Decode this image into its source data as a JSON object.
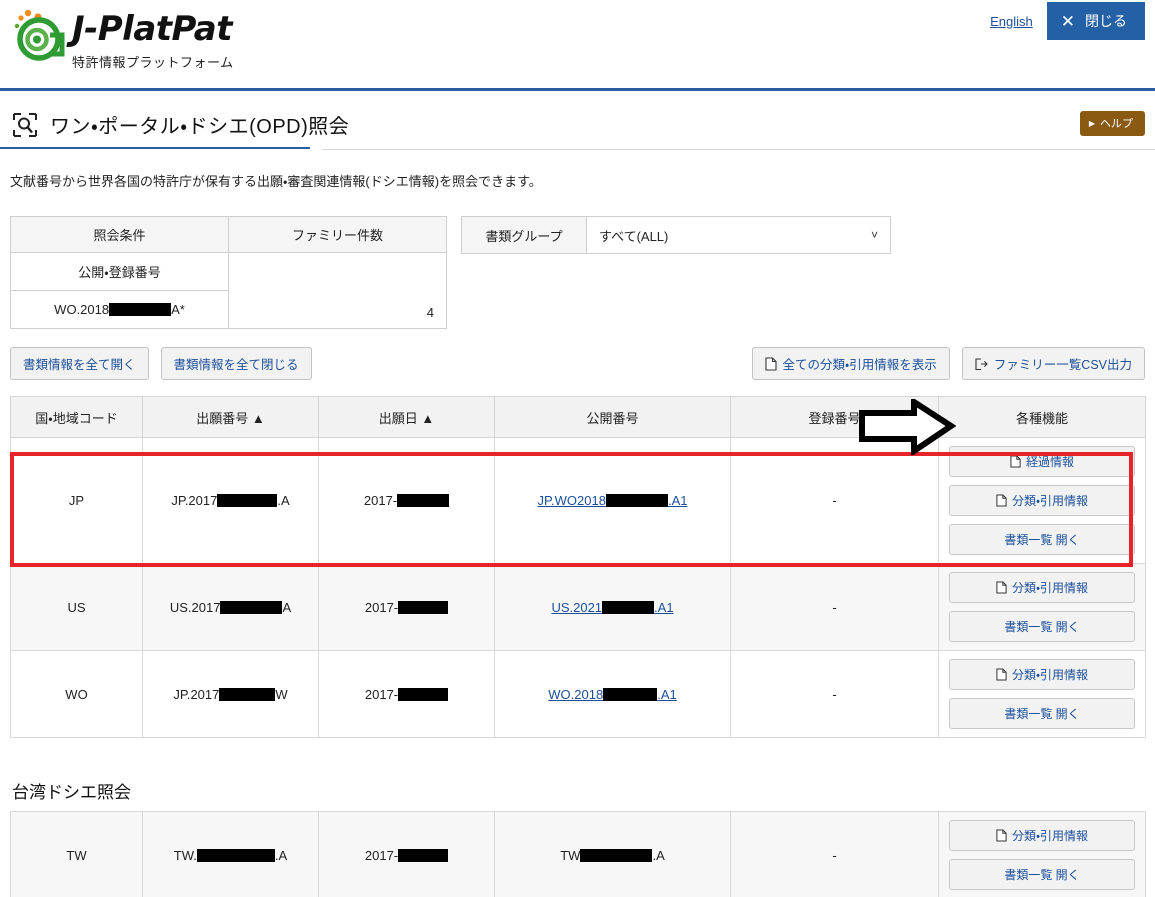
{
  "header": {
    "logo_word": "J-PlatPat",
    "logo_sub": "特許情報プラットフォーム",
    "english_link": "English",
    "close_label": "閉じる",
    "close_icon": "close-x-icon"
  },
  "title": {
    "text": "ワン・ポータル・ドシエ(OPD)照会",
    "icon": "search-document-icon",
    "help_label": "ヘルプ",
    "help_icon": "play-caret-icon"
  },
  "description": "文献番号から世界各国の特許庁が保有する出願・審査関連情報(ドシエ情報)を照会できます。",
  "condition": {
    "headers": [
      "照会条件",
      "ファミリー件数"
    ],
    "row_label": "公開・登録番号",
    "row_value_prefix": "WO.2018",
    "row_value_suffix": "A*",
    "family_count": "4"
  },
  "document_group": {
    "label": "書類グループ",
    "selected": "すべて(ALL)",
    "chevron_icon": "chevron-down-icon"
  },
  "actions": {
    "open_all": "書類情報を全て開く",
    "close_all": "書類情報を全て閉じる",
    "show_all_citations": "全ての分類・引用情報を表示",
    "csv_export": "ファミリー一覧CSV出力",
    "doc_icon": "document-icon",
    "export_icon": "export-icon"
  },
  "table": {
    "headers": [
      "国・地域コード",
      "出願番号 ▲",
      "出願日 ▲",
      "公開番号",
      "登録番号",
      "各種機能"
    ],
    "rows": [
      {
        "country": "JP",
        "app_prefix": "JP.2017",
        "app_suffix": ".A",
        "date_prefix": "2017-",
        "date_suffix": "",
        "pub_prefix": "JP.WO2018",
        "pub_suffix": ".A1",
        "pub_is_link": true,
        "reg": "-",
        "buttons": [
          "経過情報",
          "分類・引用情報",
          "書類一覧 開く"
        ]
      },
      {
        "country": "US",
        "app_prefix": "US.2017",
        "app_suffix": "A",
        "date_prefix": "2017-",
        "date_suffix": "",
        "pub_prefix": "US.2021",
        "pub_suffix": ".A1",
        "pub_is_link": true,
        "reg": "-",
        "buttons": [
          "分類・引用情報",
          "書類一覧 開く"
        ]
      },
      {
        "country": "WO",
        "app_prefix": "JP.2017",
        "app_suffix": "W",
        "date_prefix": "2017-",
        "date_suffix": "",
        "pub_prefix": "WO.2018",
        "pub_suffix": ".A1",
        "pub_is_link": true,
        "reg": "-",
        "buttons": [
          "分類・引用情報",
          "書類一覧 開く"
        ]
      }
    ]
  },
  "taiwan": {
    "heading": "台湾ドシエ照会",
    "row": {
      "country": "TW",
      "app_prefix": "TW.",
      "app_suffix": ".A",
      "date_prefix": "2017-",
      "date_suffix": "",
      "pub_prefix": "TW",
      "pub_suffix": ".A",
      "pub_is_link": false,
      "reg": "-",
      "buttons": [
        "分類・引用情報",
        "書類一覧 開く"
      ]
    }
  },
  "annotations": {
    "highlight_color": "#e8232a",
    "arrow_icon": "right-arrow-annotation",
    "arrow_target": "経過情報"
  }
}
